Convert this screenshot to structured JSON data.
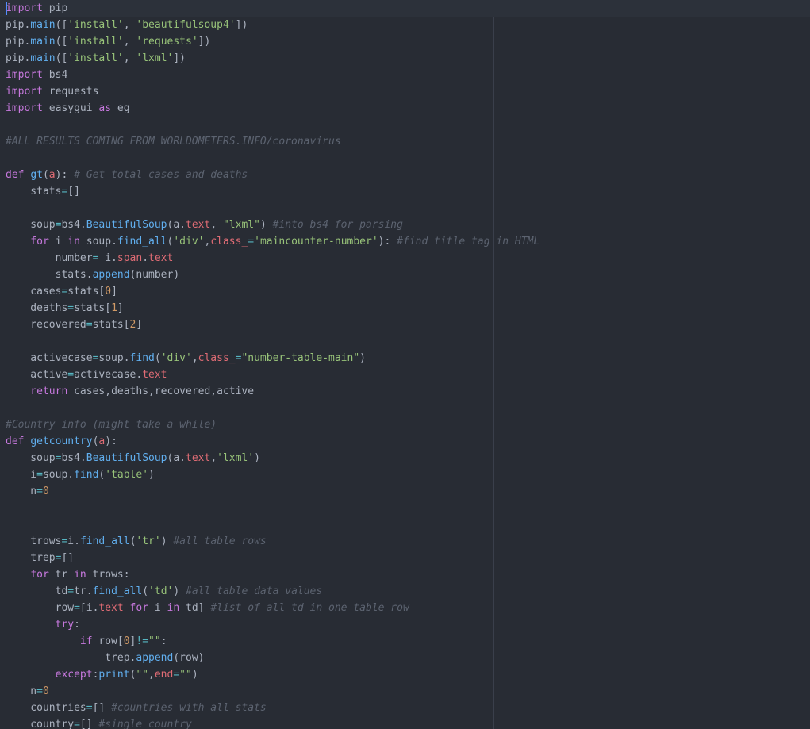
{
  "colors": {
    "background": "#282c34",
    "current_line": "#2c313a",
    "cursor": "#528bff",
    "keyword": "#c678dd",
    "function": "#61afef",
    "string": "#98c379",
    "number": "#d19a66",
    "operator": "#56b6c2",
    "attribute": "#e06c75",
    "comment": "#5c6370",
    "text": "#abb2bf"
  },
  "editor": {
    "lines": [
      [
        [
          "kw",
          "import"
        ],
        [
          "var",
          " pip"
        ]
      ],
      [
        [
          "var",
          "pip."
        ],
        [
          "fn",
          "main"
        ],
        [
          "punc",
          "(["
        ],
        [
          "str",
          "'install'"
        ],
        [
          "punc",
          ", "
        ],
        [
          "str",
          "'beautifulsoup4'"
        ],
        [
          "punc",
          "])"
        ]
      ],
      [
        [
          "var",
          "pip."
        ],
        [
          "fn",
          "main"
        ],
        [
          "punc",
          "(["
        ],
        [
          "str",
          "'install'"
        ],
        [
          "punc",
          ", "
        ],
        [
          "str",
          "'requests'"
        ],
        [
          "punc",
          "])"
        ]
      ],
      [
        [
          "var",
          "pip."
        ],
        [
          "fn",
          "main"
        ],
        [
          "punc",
          "(["
        ],
        [
          "str",
          "'install'"
        ],
        [
          "punc",
          ", "
        ],
        [
          "str",
          "'lxml'"
        ],
        [
          "punc",
          "])"
        ]
      ],
      [
        [
          "kw",
          "import"
        ],
        [
          "var",
          " bs4"
        ]
      ],
      [
        [
          "kw",
          "import"
        ],
        [
          "var",
          " requests"
        ]
      ],
      [
        [
          "kw",
          "import"
        ],
        [
          "var",
          " easygui "
        ],
        [
          "kw",
          "as"
        ],
        [
          "var",
          " eg"
        ]
      ],
      [],
      [
        [
          "cmt",
          "#ALL RESULTS COMING FROM WORLDOMETERS.INFO/coronavirus"
        ]
      ],
      [],
      [
        [
          "kw",
          "def"
        ],
        [
          "var",
          " "
        ],
        [
          "fn",
          "gt"
        ],
        [
          "punc",
          "("
        ],
        [
          "attr",
          "a"
        ],
        [
          "punc",
          "): "
        ],
        [
          "cmt",
          "# Get total cases and deaths"
        ]
      ],
      [
        [
          "var",
          "    stats"
        ],
        [
          "op",
          "="
        ],
        [
          "punc",
          "[]"
        ]
      ],
      [],
      [
        [
          "var",
          "    soup"
        ],
        [
          "op",
          "="
        ],
        [
          "var",
          "bs4."
        ],
        [
          "fn",
          "BeautifulSoup"
        ],
        [
          "punc",
          "(a."
        ],
        [
          "attr",
          "text"
        ],
        [
          "punc",
          ", "
        ],
        [
          "str",
          "\"lxml\""
        ],
        [
          "punc",
          ") "
        ],
        [
          "cmt",
          "#into bs4 for parsing"
        ]
      ],
      [
        [
          "kw",
          "    for"
        ],
        [
          "var",
          " i "
        ],
        [
          "kw",
          "in"
        ],
        [
          "var",
          " soup."
        ],
        [
          "fn",
          "find_all"
        ],
        [
          "punc",
          "("
        ],
        [
          "str",
          "'div'"
        ],
        [
          "punc",
          ","
        ],
        [
          "attr",
          "class_"
        ],
        [
          "op",
          "="
        ],
        [
          "str",
          "'maincounter-number'"
        ],
        [
          "punc",
          "): "
        ],
        [
          "cmt",
          "#find title tag in HTML"
        ]
      ],
      [
        [
          "var",
          "        number"
        ],
        [
          "op",
          "="
        ],
        [
          "var",
          " i."
        ],
        [
          "attr",
          "span"
        ],
        [
          "punc",
          "."
        ],
        [
          "attr",
          "text"
        ]
      ],
      [
        [
          "var",
          "        stats."
        ],
        [
          "fn",
          "append"
        ],
        [
          "punc",
          "(number)"
        ]
      ],
      [
        [
          "var",
          "    cases"
        ],
        [
          "op",
          "="
        ],
        [
          "var",
          "stats["
        ],
        [
          "num",
          "0"
        ],
        [
          "punc",
          "]"
        ]
      ],
      [
        [
          "var",
          "    deaths"
        ],
        [
          "op",
          "="
        ],
        [
          "var",
          "stats["
        ],
        [
          "num",
          "1"
        ],
        [
          "punc",
          "]"
        ]
      ],
      [
        [
          "var",
          "    recovered"
        ],
        [
          "op",
          "="
        ],
        [
          "var",
          "stats["
        ],
        [
          "num",
          "2"
        ],
        [
          "punc",
          "]"
        ]
      ],
      [],
      [
        [
          "var",
          "    activecase"
        ],
        [
          "op",
          "="
        ],
        [
          "var",
          "soup."
        ],
        [
          "fn",
          "find"
        ],
        [
          "punc",
          "("
        ],
        [
          "str",
          "'div'"
        ],
        [
          "punc",
          ","
        ],
        [
          "attr",
          "class_"
        ],
        [
          "op",
          "="
        ],
        [
          "str",
          "\"number-table-main\""
        ],
        [
          "punc",
          ")"
        ]
      ],
      [
        [
          "var",
          "    active"
        ],
        [
          "op",
          "="
        ],
        [
          "var",
          "activecase."
        ],
        [
          "attr",
          "text"
        ]
      ],
      [
        [
          "kw",
          "    return"
        ],
        [
          "var",
          " cases,deaths,recovered,active"
        ]
      ],
      [],
      [
        [
          "cmt",
          "#Country info (might take a while)"
        ]
      ],
      [
        [
          "kw",
          "def"
        ],
        [
          "var",
          " "
        ],
        [
          "fn",
          "getcountry"
        ],
        [
          "punc",
          "("
        ],
        [
          "attr",
          "a"
        ],
        [
          "punc",
          "):"
        ]
      ],
      [
        [
          "var",
          "    soup"
        ],
        [
          "op",
          "="
        ],
        [
          "var",
          "bs4."
        ],
        [
          "fn",
          "BeautifulSoup"
        ],
        [
          "punc",
          "(a."
        ],
        [
          "attr",
          "text"
        ],
        [
          "punc",
          ","
        ],
        [
          "str",
          "'lxml'"
        ],
        [
          "punc",
          ")"
        ]
      ],
      [
        [
          "var",
          "    i"
        ],
        [
          "op",
          "="
        ],
        [
          "var",
          "soup."
        ],
        [
          "fn",
          "find"
        ],
        [
          "punc",
          "("
        ],
        [
          "str",
          "'table'"
        ],
        [
          "punc",
          ")"
        ]
      ],
      [
        [
          "var",
          "    n"
        ],
        [
          "op",
          "="
        ],
        [
          "num",
          "0"
        ]
      ],
      [],
      [],
      [
        [
          "var",
          "    trows"
        ],
        [
          "op",
          "="
        ],
        [
          "var",
          "i."
        ],
        [
          "fn",
          "find_all"
        ],
        [
          "punc",
          "("
        ],
        [
          "str",
          "'tr'"
        ],
        [
          "punc",
          ") "
        ],
        [
          "cmt",
          "#all table rows"
        ]
      ],
      [
        [
          "var",
          "    trep"
        ],
        [
          "op",
          "="
        ],
        [
          "punc",
          "[]"
        ]
      ],
      [
        [
          "kw",
          "    for"
        ],
        [
          "var",
          " tr "
        ],
        [
          "kw",
          "in"
        ],
        [
          "var",
          " trows:"
        ]
      ],
      [
        [
          "var",
          "        td"
        ],
        [
          "op",
          "="
        ],
        [
          "var",
          "tr."
        ],
        [
          "fn",
          "find_all"
        ],
        [
          "punc",
          "("
        ],
        [
          "str",
          "'td'"
        ],
        [
          "punc",
          ") "
        ],
        [
          "cmt",
          "#all table data values"
        ]
      ],
      [
        [
          "var",
          "        row"
        ],
        [
          "op",
          "="
        ],
        [
          "punc",
          "[i."
        ],
        [
          "attr",
          "text"
        ],
        [
          "kw",
          " for"
        ],
        [
          "var",
          " i "
        ],
        [
          "kw",
          "in"
        ],
        [
          "var",
          " td] "
        ],
        [
          "cmt",
          "#list of all td in one table row"
        ]
      ],
      [
        [
          "kw",
          "        try"
        ],
        [
          "punc",
          ":"
        ]
      ],
      [
        [
          "kw",
          "            if"
        ],
        [
          "var",
          " row["
        ],
        [
          "num",
          "0"
        ],
        [
          "punc",
          "]"
        ],
        [
          "op",
          "!="
        ],
        [
          "str",
          "\"\""
        ],
        [
          "punc",
          ":"
        ]
      ],
      [
        [
          "var",
          "                trep."
        ],
        [
          "fn",
          "append"
        ],
        [
          "punc",
          "(row)"
        ]
      ],
      [
        [
          "kw",
          "        except"
        ],
        [
          "punc",
          ":"
        ],
        [
          "fn",
          "print"
        ],
        [
          "punc",
          "("
        ],
        [
          "str",
          "\"\""
        ],
        [
          "punc",
          ","
        ],
        [
          "attr",
          "end"
        ],
        [
          "op",
          "="
        ],
        [
          "str",
          "\"\""
        ],
        [
          "punc",
          ")"
        ]
      ],
      [
        [
          "var",
          "    n"
        ],
        [
          "op",
          "="
        ],
        [
          "num",
          "0"
        ]
      ],
      [
        [
          "var",
          "    countries"
        ],
        [
          "op",
          "="
        ],
        [
          "punc",
          "[] "
        ],
        [
          "cmt",
          "#countries with all stats"
        ]
      ],
      [
        [
          "var",
          "    country"
        ],
        [
          "op",
          "="
        ],
        [
          "punc",
          "[] "
        ],
        [
          "cmt",
          "#single country"
        ]
      ]
    ]
  }
}
